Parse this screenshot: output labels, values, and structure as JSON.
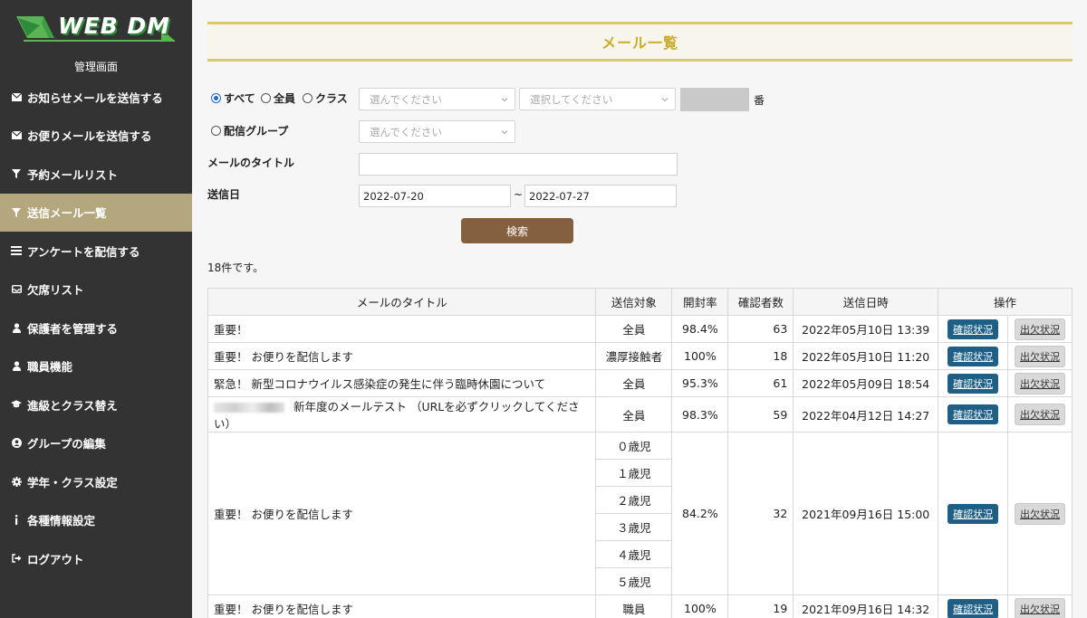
{
  "logo": {
    "text": "WEB DM",
    "colors": {
      "green": "#2e8b3a",
      "light": "#5ab552"
    }
  },
  "sidebar": {
    "admin_label": "管理画面",
    "items": [
      {
        "label": "お知らせメールを送信する",
        "icon": "envelope-icon",
        "active": false
      },
      {
        "label": "お便りメールを送信する",
        "icon": "envelope-icon",
        "active": false
      },
      {
        "label": "予約メールリスト",
        "icon": "filter-icon",
        "active": false
      },
      {
        "label": "送信メール一覧",
        "icon": "filter-icon",
        "active": true
      },
      {
        "label": "アンケートを配信する",
        "icon": "list-icon",
        "active": false
      },
      {
        "label": "欠席リスト",
        "icon": "inbox-icon",
        "active": false
      },
      {
        "label": "保護者を管理する",
        "icon": "user-icon",
        "active": false
      },
      {
        "label": "職員機能",
        "icon": "user-icon",
        "active": false
      },
      {
        "label": "進級とクラス替え",
        "icon": "graduation-cap-icon",
        "active": false
      },
      {
        "label": "グループの編集",
        "icon": "user-circle-icon",
        "active": false
      },
      {
        "label": "学年・クラス設定",
        "icon": "gear-icon",
        "active": false
      },
      {
        "label": "各種情報設定",
        "icon": "info-icon",
        "active": false
      },
      {
        "label": "ログアウト",
        "icon": "sign-out-icon",
        "active": false
      }
    ]
  },
  "page_title": "メール一覧",
  "filters": {
    "radio_all": "すべて",
    "radio_everyone": "全員",
    "radio_class": "クラス",
    "class_select_placeholder": "選んでください",
    "number_select_placeholder": "選択してください",
    "number_suffix": "番",
    "radio_group": "配信グループ",
    "group_select_placeholder": "選んでください",
    "title_label": "メールのタイトル",
    "title_value": "",
    "date_label": "送信日",
    "date_from": "2022-07-20",
    "date_sep": "~",
    "date_to": "2022-07-27",
    "search_button": "検索"
  },
  "result_count": "18件です。",
  "table": {
    "headers": [
      "メールのタイトル",
      "送信対象",
      "開封率",
      "確認者数",
      "送信日時",
      "操作"
    ],
    "confirm_label": "確認状況",
    "attendance_label": "出欠状況",
    "rows": [
      {
        "title": "重要！",
        "target": "全員",
        "open_rate": "98.4%",
        "confirmed": "63",
        "sent_at": "2022年05月10日 13:39"
      },
      {
        "title": "重要！ お便りを配信します",
        "target": "濃厚接触者",
        "open_rate": "100%",
        "confirmed": "18",
        "sent_at": "2022年05月10日 11:20"
      },
      {
        "title": "緊急！ 新型コロナウイルス感染症の発生に伴う臨時休園について",
        "target": "全員",
        "open_rate": "95.3%",
        "confirmed": "61",
        "sent_at": "2022年05月09日 18:54"
      },
      {
        "title": "新年度のメールテスト （URLを必ずクリックしてください）",
        "target": "全員",
        "open_rate": "98.3%",
        "confirmed": "59",
        "sent_at": "2022年04月12日 14:27"
      },
      {
        "title": "重要！ お便りを配信します",
        "targets": [
          "０歳児",
          "１歳児",
          "２歳児",
          "３歳児",
          "４歳児",
          "５歳児"
        ],
        "open_rate": "84.2%",
        "confirmed": "32",
        "sent_at": "2021年09月16日 15:00"
      },
      {
        "title": "重要！ お便りを配信します",
        "target": "職員",
        "open_rate": "100%",
        "confirmed": "19",
        "sent_at": "2021年09月16日 14:32"
      }
    ]
  }
}
